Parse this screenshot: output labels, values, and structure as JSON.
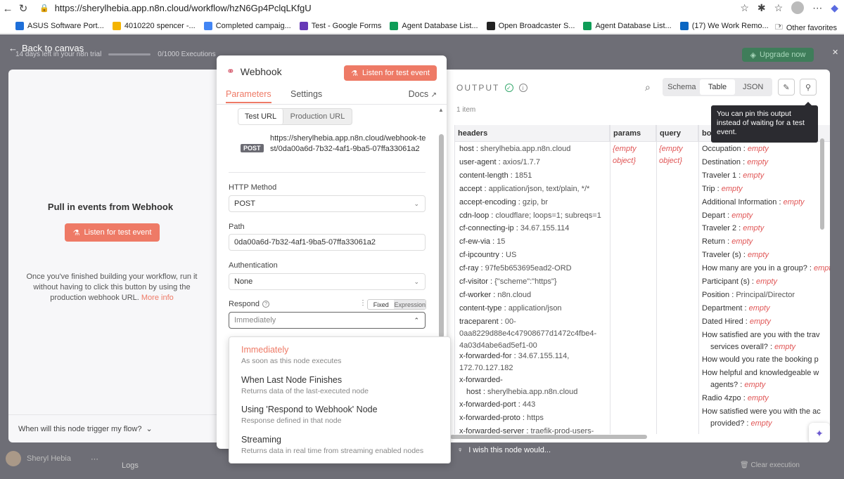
{
  "browser": {
    "url": "https://sherylhebia.app.n8n.cloud/workflow/hzN6Gp4PclqLKfgU",
    "bookmarks": [
      {
        "label": "ASUS Software Port...",
        "color": "#1e6fd9"
      },
      {
        "label": "4010220 spencer -...",
        "color": "#f4b400"
      },
      {
        "label": "Completed campaig...",
        "color": "#4285f4"
      },
      {
        "label": "Test - Google Forms",
        "color": "#673ab7"
      },
      {
        "label": "Agent Database List...",
        "color": "#0f9d58"
      },
      {
        "label": "Open Broadcaster S...",
        "color": "#222222"
      },
      {
        "label": "Agent Database List...",
        "color": "#0f9d58"
      },
      {
        "label": "(17) We Work Remo...",
        "color": "#0a66c2"
      }
    ],
    "other_favorites": "Other favorites"
  },
  "background": {
    "back_to_canvas": "Back to canvas",
    "trial_text": "14 days left in your n8n trial",
    "trial_progress": 0.0,
    "executions": "0/1000 Executions",
    "upgrade": "Upgrade now",
    "user_name": "Sheryl Hebia",
    "logs": "Logs",
    "clear_execution": "Clear execution"
  },
  "left": {
    "title": "Pull in events from Webhook",
    "listen_button": "Listen for test event",
    "description": "Once you've finished building your workflow, run it without having to click this button by using the production webhook URL.",
    "more_info": "More info",
    "footer": "When will this node trigger my flow?"
  },
  "node": {
    "title": "Webhook",
    "listen_button": "Listen for test event",
    "tabs": {
      "parameters": "Parameters",
      "settings": "Settings",
      "docs": "Docs"
    },
    "url_toggle": {
      "test": "Test URL",
      "production": "Production URL"
    },
    "method_badge": "POST",
    "webhook_url": "https://sherylhebia.app.n8n.cloud/webhook-test/0da00a6d-7b32-4af1-9ba5-07ffa33061a2",
    "http_method_label": "HTTP Method",
    "http_method_value": "POST",
    "path_label": "Path",
    "path_value": "0da00a6d-7b32-4af1-9ba5-07ffa33061a2",
    "auth_label": "Authentication",
    "auth_value": "None",
    "respond_label": "Respond",
    "fixed": "Fixed",
    "expression": "Expression",
    "respond_value": "Immediately"
  },
  "dropdown": [
    {
      "label": "Immediately",
      "desc": "As soon as this node executes"
    },
    {
      "label": "When Last Node Finishes",
      "desc": "Returns data of the last-executed node"
    },
    {
      "label": "Using 'Respond to Webhook' Node",
      "desc": "Response defined in that node"
    },
    {
      "label": "Streaming",
      "desc": "Returns data in real time from streaming enabled nodes"
    }
  ],
  "output": {
    "title": "OUTPUT",
    "views": {
      "schema": "Schema",
      "table": "Table",
      "json": "JSON"
    },
    "item_count": "1 item",
    "columns": {
      "headers": "headers",
      "params": "params",
      "query": "query",
      "body": "body"
    },
    "empty_object": "{empty object}",
    "empty": "empty",
    "tooltip": "You can pin this output instead of waiting for a test event.",
    "headers": [
      {
        "k": "host",
        "v": "sherylhebia.app.n8n.cloud"
      },
      {
        "k": "user-agent",
        "v": "axios/1.7.7"
      },
      {
        "k": "content-length",
        "v": "1851"
      },
      {
        "k": "accept",
        "v": "application/json, text/plain, */*"
      },
      {
        "k": "accept-encoding",
        "v": "gzip, br"
      },
      {
        "k": "cdn-loop",
        "v": "cloudflare; loops=1; subreqs=1"
      },
      {
        "k": "cf-connecting-ip",
        "v": "34.67.155.114"
      },
      {
        "k": "cf-ew-via",
        "v": "15"
      },
      {
        "k": "cf-ipcountry",
        "v": "US"
      },
      {
        "k": "cf-ray",
        "v": "97fe5b653695ead2-ORD"
      },
      {
        "k": "cf-visitor",
        "v": "{\"scheme\":\"https\"}"
      },
      {
        "k": "cf-worker",
        "v": "n8n.cloud"
      },
      {
        "k": "content-type",
        "v": "application/json"
      }
    ],
    "traceparent_k": "traceparent",
    "traceparent_v1": "00-",
    "traceparent_v2": "0aa8229d88e4c47908677d1472c4fbe4-",
    "traceparent_v3": "4a03d4abe6ad5ef1-00",
    "xff_k": "x-forwarded-for",
    "xff_v1": "34.67.155.114,",
    "xff_v2": "172.70.127.182",
    "xfh_k1": "x-forwarded-",
    "xfh_k2": "host",
    "xfh_v": "sherylhebia.app.n8n.cloud",
    "xfport_k": "x-forwarded-port",
    "xfport_v": "443",
    "xfproto_k": "x-forwarded-proto",
    "xfproto_v": "https",
    "xfserver_k": "x-forwarded-server",
    "xfserver_v": "traefik-prod-users-",
    "body": [
      "Occupation",
      "Destination",
      "Traveler 1",
      "Trip",
      "Additional Information",
      "Depart",
      "Traveler 2",
      "Return",
      "Traveler (s)",
      "How many are you in a group?",
      "Participant (s)"
    ],
    "position_k": "Position",
    "position_v": "Principal/Director",
    "body2": [
      "Department",
      "Dated Hired"
    ],
    "q1a": "How satisfied are you with the trav",
    "q1b": "services overall?",
    "q2": "How would you rate the booking p",
    "q3a": "How helpful and knowledgeable w",
    "q3b": "agents?",
    "radio": "Radio 4zpo",
    "q4a": "How satisfied were you with the ac",
    "q4b": "provided?"
  },
  "wish": "I wish this node would..."
}
